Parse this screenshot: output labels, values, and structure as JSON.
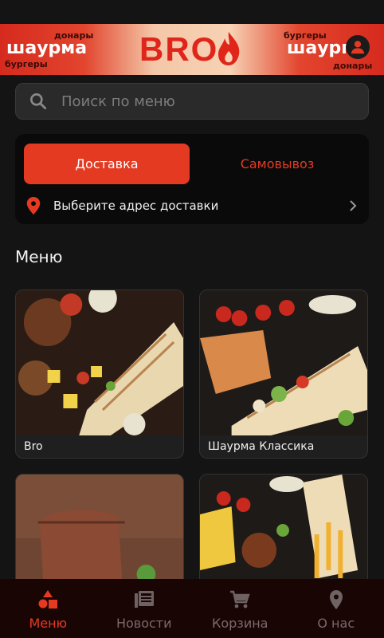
{
  "banner": {
    "left_small_top": "донары",
    "left_big": "шаурма",
    "left_small_bottom": "бургеры",
    "brand": "BRO",
    "right_small_top": "бургеры",
    "right_big": "шаурма",
    "right_small_bottom": "донары"
  },
  "search": {
    "placeholder": "Поиск по меню"
  },
  "delivery": {
    "tab_delivery": "Доставка",
    "tab_pickup": "Самовывоз",
    "address_prompt": "Выберите адрес доставки"
  },
  "menu": {
    "title": "Меню",
    "items": [
      {
        "name": "Bro"
      },
      {
        "name": "Шаурма Классика"
      },
      {
        "name": ""
      },
      {
        "name": ""
      }
    ]
  },
  "nav": {
    "items": [
      {
        "label": "Меню",
        "icon": "menu-shapes-icon"
      },
      {
        "label": "Новости",
        "icon": "news-icon"
      },
      {
        "label": "Корзина",
        "icon": "cart-icon"
      },
      {
        "label": "О нас",
        "icon": "location-icon"
      }
    ]
  },
  "colors": {
    "accent": "#e43a22",
    "background": "#141414",
    "card": "#0a0a0a"
  }
}
